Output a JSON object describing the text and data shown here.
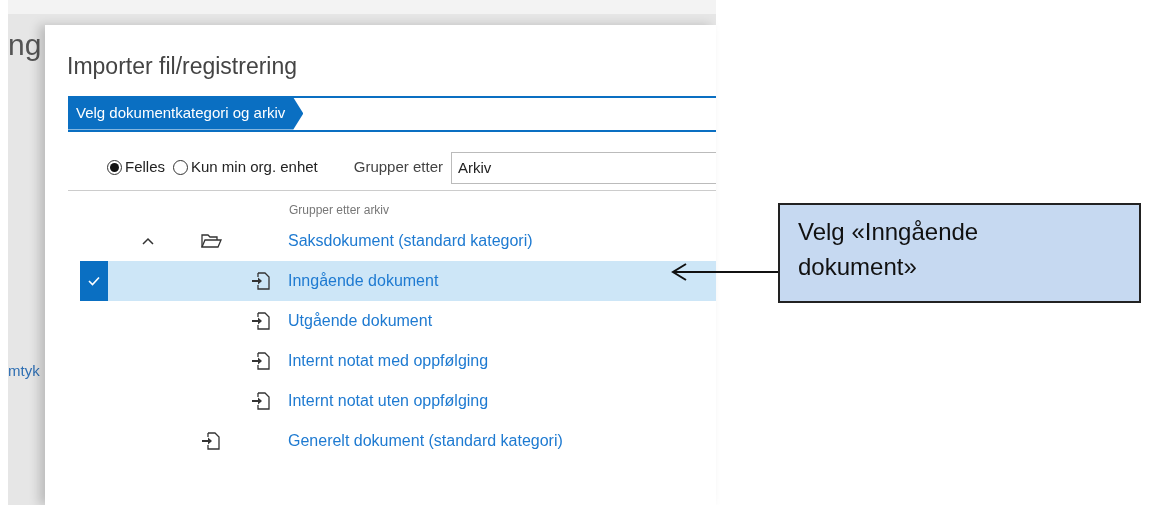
{
  "background_page": {
    "heading_fragment": "ng",
    "link_fragment": "mtyk"
  },
  "dialog": {
    "title": "Importer fil/registrering",
    "step": "Velg dokumentkategori og arkiv",
    "scope_options": [
      {
        "label": "Felles",
        "selected": true
      },
      {
        "label": "Kun min org. enhet",
        "selected": false
      }
    ],
    "group_by": {
      "label": "Grupper etter",
      "value": "Arkiv"
    },
    "list_header": "Grupper etter arkiv",
    "tree": [
      {
        "label": "Saksdokument (standard kategori)",
        "kind": "folder",
        "expanded": true,
        "selected": false,
        "children": [
          {
            "label": "Inngående dokument",
            "kind": "document",
            "selected": true
          },
          {
            "label": "Utgående dokument",
            "kind": "document",
            "selected": false
          },
          {
            "label": "Internt notat med oppfølging",
            "kind": "document",
            "selected": false
          },
          {
            "label": "Internt notat uten oppfølging",
            "kind": "document",
            "selected": false
          }
        ]
      },
      {
        "label": "Generelt dokument (standard kategori)",
        "kind": "document",
        "selected": false
      }
    ]
  },
  "callout": {
    "text": "Velg «Inngående dokument»"
  }
}
